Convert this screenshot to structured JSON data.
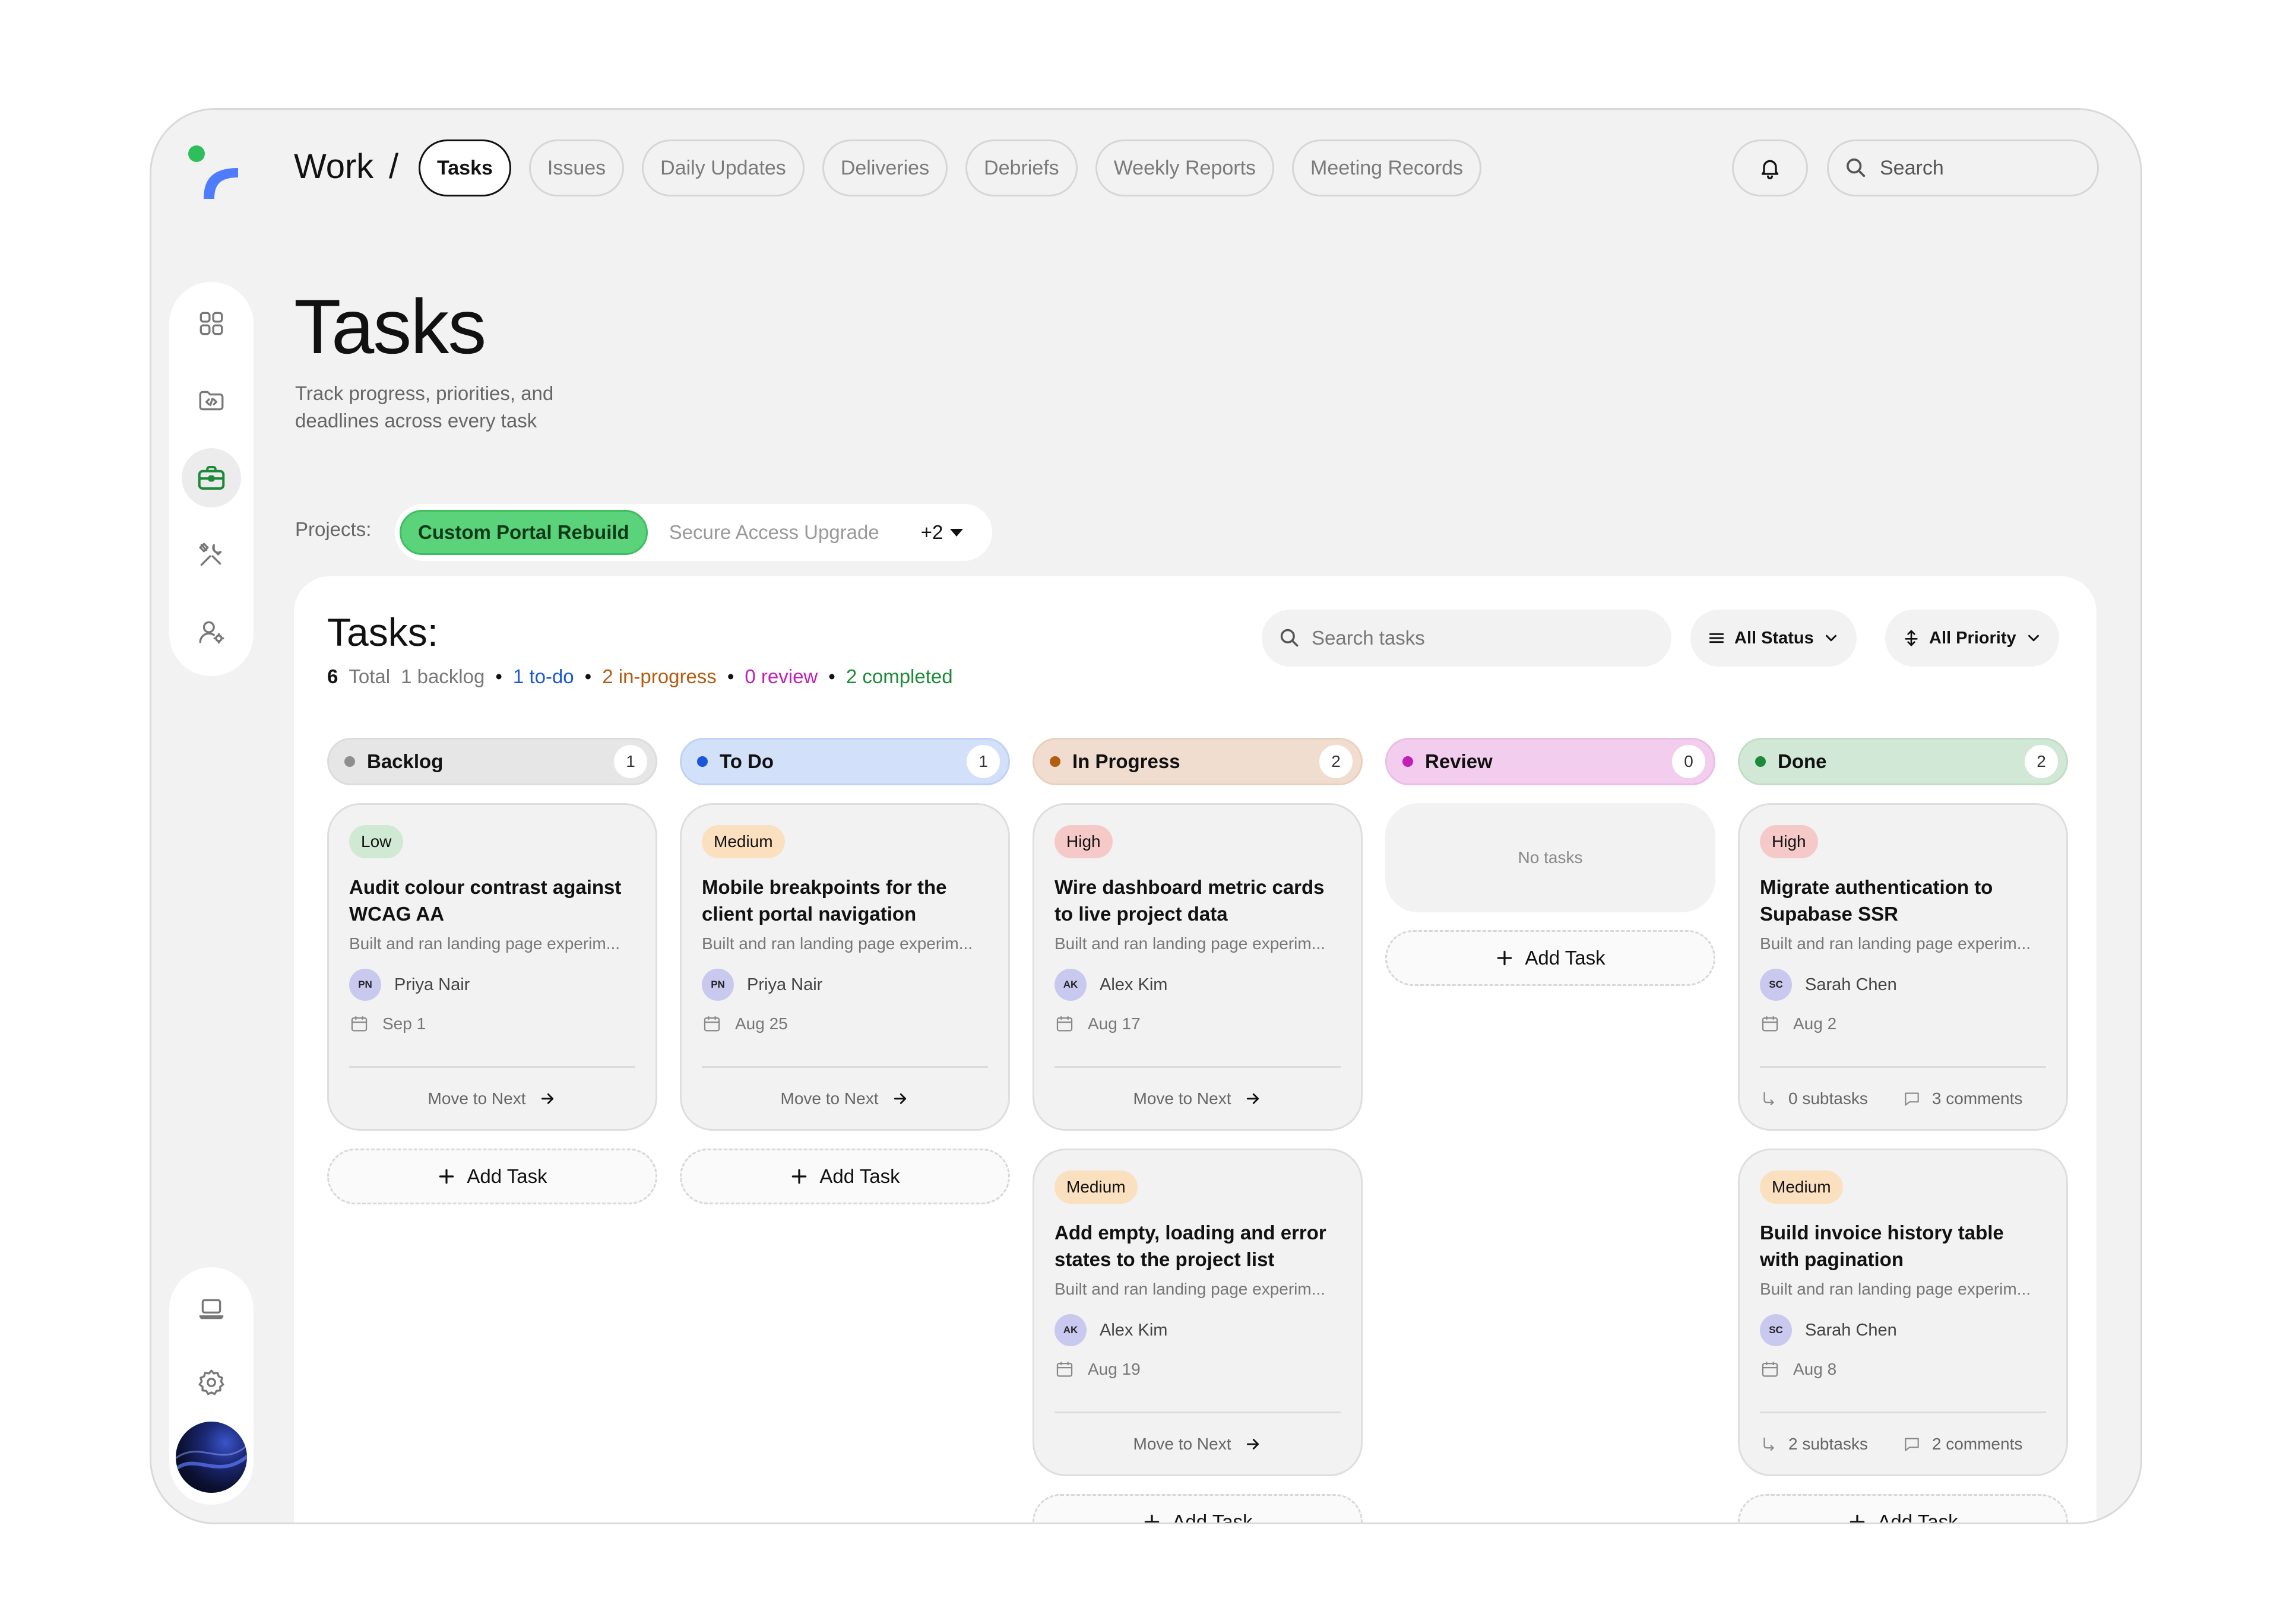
{
  "nav": {
    "section": "Work",
    "separator": "/",
    "tabs": [
      {
        "label": "Tasks",
        "active": true
      },
      {
        "label": "Issues"
      },
      {
        "label": "Daily Updates"
      },
      {
        "label": "Deliveries"
      },
      {
        "label": "Debriefs"
      },
      {
        "label": "Weekly Reports"
      },
      {
        "label": "Meeting Records"
      }
    ],
    "search_placeholder": "Search"
  },
  "sidebar": {
    "items": [
      "grid-icon",
      "code-folder-icon",
      "briefcase-icon",
      "tools-icon",
      "user-settings-icon"
    ],
    "active_index": 2,
    "bottom_items": [
      "laptop-icon",
      "settings-gear-icon",
      "user-avatar"
    ]
  },
  "header": {
    "title": "Tasks",
    "subtitle": "Track progress, priorities, and deadlines across every task"
  },
  "projects": {
    "label": "Projects:",
    "active": "Custom Portal Rebuild",
    "other": "Secure Access Upgrade",
    "more": "+2"
  },
  "board": {
    "title": "Tasks:",
    "stats": {
      "total_num": "6",
      "total_label": "Total",
      "backlog": "1 backlog",
      "todo": "1 to-do",
      "in_progress": "2 in-progress",
      "review": "0 review",
      "completed": "2 completed"
    },
    "search_placeholder": "Search tasks",
    "status_filter": "All Status",
    "priority_filter": "All Priority",
    "add_task_label": "Add Task",
    "move_label": "Move to Next",
    "empty_label": "No tasks",
    "colors": {
      "backlog": "#8e8e8e",
      "todo": "#1a56db",
      "in_progress": "#b35c12",
      "review": "#c21fb5",
      "done": "#1d8a3a"
    },
    "columns": [
      {
        "name": "Backlog",
        "count": "1",
        "cards": [
          {
            "priority": "Low",
            "title": "Audit colour contrast against WCAG AA",
            "desc": "Built and ran landing page experim...",
            "initials": "PN",
            "user": "Priya Nair",
            "date": "Sep 1"
          }
        ]
      },
      {
        "name": "To Do",
        "count": "1",
        "cards": [
          {
            "priority": "Medium",
            "title": "Mobile breakpoints for the client portal navigation",
            "desc": "Built and ran landing page experim...",
            "initials": "PN",
            "user": "Priya Nair",
            "date": "Aug 25"
          }
        ]
      },
      {
        "name": "In Progress",
        "count": "2",
        "cards": [
          {
            "priority": "High",
            "title": "Wire dashboard metric cards to live project data",
            "desc": "Built and ran landing page experim...",
            "initials": "AK",
            "user": "Alex Kim",
            "date": "Aug 17"
          },
          {
            "priority": "Medium",
            "title": "Add empty, loading and error states to the project list",
            "desc": "Built and ran landing page experim...",
            "initials": "AK",
            "user": "Alex Kim",
            "date": "Aug 19"
          }
        ]
      },
      {
        "name": "Review",
        "count": "0",
        "cards": []
      },
      {
        "name": "Done",
        "count": "2",
        "cards": [
          {
            "priority": "High",
            "title": "Migrate authentication to Supabase SSR",
            "desc": "Built and ran landing page experim...",
            "initials": "SC",
            "user": "Sarah Chen",
            "date": "Aug 2",
            "subtasks": "0 subtasks",
            "comments": "3 comments"
          },
          {
            "priority": "Medium",
            "title": "Build invoice history table with pagination",
            "desc": "Built and ran landing page experim...",
            "initials": "SC",
            "user": "Sarah Chen",
            "date": "Aug 8",
            "subtasks": "2 subtasks",
            "comments": "2 comments"
          }
        ]
      }
    ]
  }
}
